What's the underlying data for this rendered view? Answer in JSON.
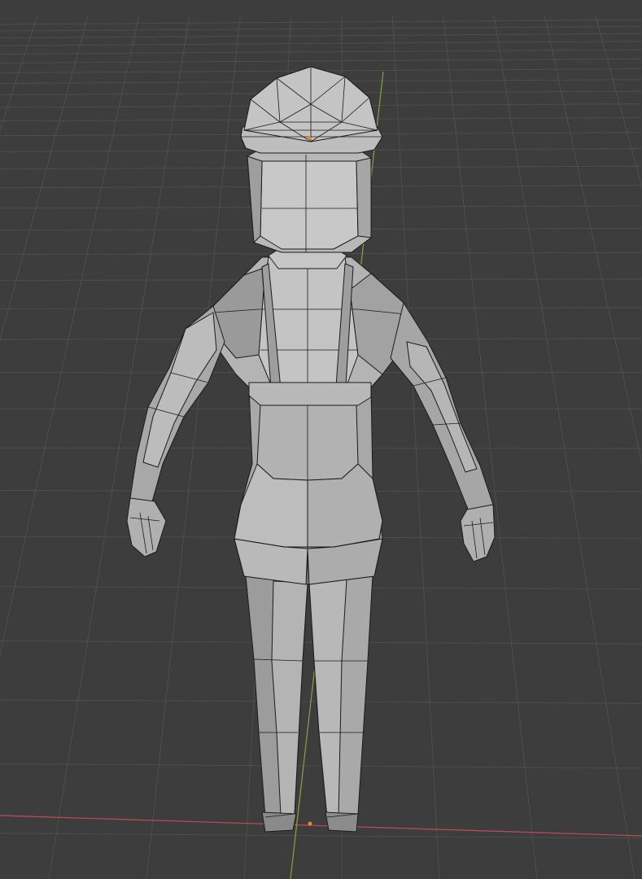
{
  "viewport": {
    "background_color": "#3d3d3d",
    "grid_color": "#4e4e4e",
    "x_axis_color": "#c14a5a",
    "y_axis_color": "#7fa83a",
    "mesh_color": "#a6a6a6",
    "wire_color": "#1b1b1b",
    "origin_color": "#e08a2e",
    "view_mode": "solid",
    "model_view": "back"
  }
}
